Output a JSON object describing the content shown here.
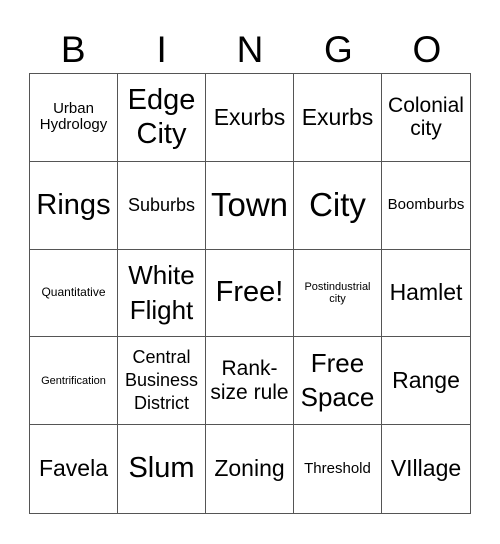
{
  "header": [
    "B",
    "I",
    "N",
    "G",
    "O"
  ],
  "cells": [
    "Urban Hydrology",
    "Edge City",
    "Exurbs",
    "Exurbs",
    "Colonial city",
    "Rings",
    "Suburbs",
    "Town",
    "City",
    "Boomburbs",
    "Quantitative",
    "White Flight",
    "Free!",
    "Postindustrial city",
    "Hamlet",
    "Gentrification",
    "Central Business District",
    "Rank-size rule",
    "Free Space",
    "Range",
    "Favela",
    "Slum",
    "Zoning",
    "Threshold",
    "VIllage"
  ]
}
